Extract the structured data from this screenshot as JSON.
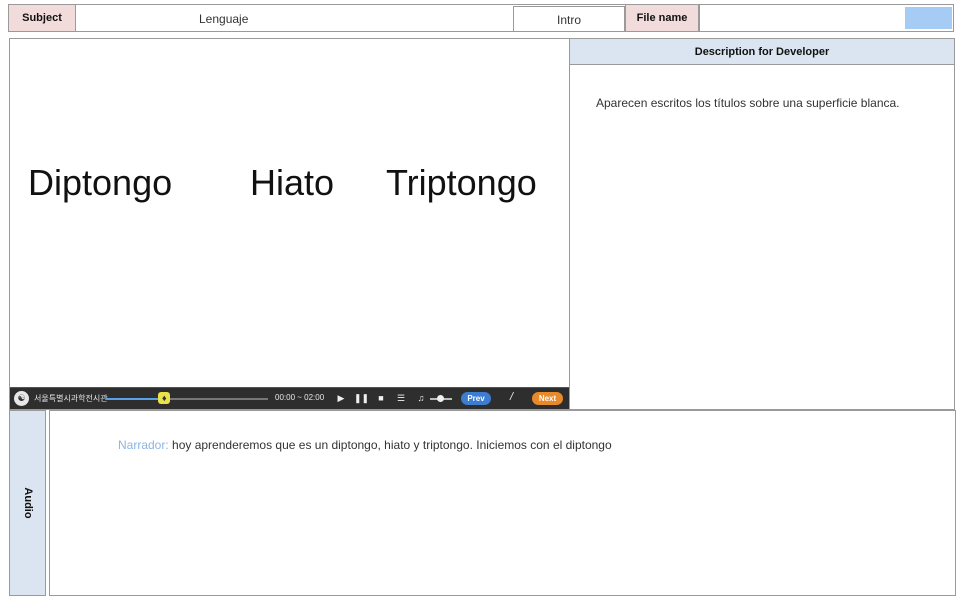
{
  "header": {
    "subject_label": "Subject",
    "subject_value": "Lenguaje",
    "intro_label": "Intro",
    "file_name_label": "File name",
    "file_name_value": ""
  },
  "stage": {
    "words": [
      "Diptongo",
      "Hiato",
      "Triptongo"
    ]
  },
  "player": {
    "logo_icon": "seoul-science-center-logo",
    "brand": "서울특별시과학전시관",
    "progress": 0.36,
    "time": "00:00 ~ 02:00",
    "prev_label": "Prev",
    "separator": "/",
    "next_label": "Next"
  },
  "description": {
    "title": "Description for Developer",
    "text": "Aparecen escritos los títulos  sobre una superficie blanca."
  },
  "audio": {
    "label": "Audio",
    "narrator_label": "Narrador:",
    "narration": "hoy aprenderemos  que es un diptongo,  hiato y triptongo.  Iniciemos con el diptongo"
  },
  "colors": {
    "label_pink": "#f2dcdb",
    "panel_blue": "#dbe5f1",
    "file_blue": "#a6ccf5",
    "narrator": "#8db4e2",
    "prev_button": "#3c7dd1",
    "next_button": "#e88a2a"
  }
}
